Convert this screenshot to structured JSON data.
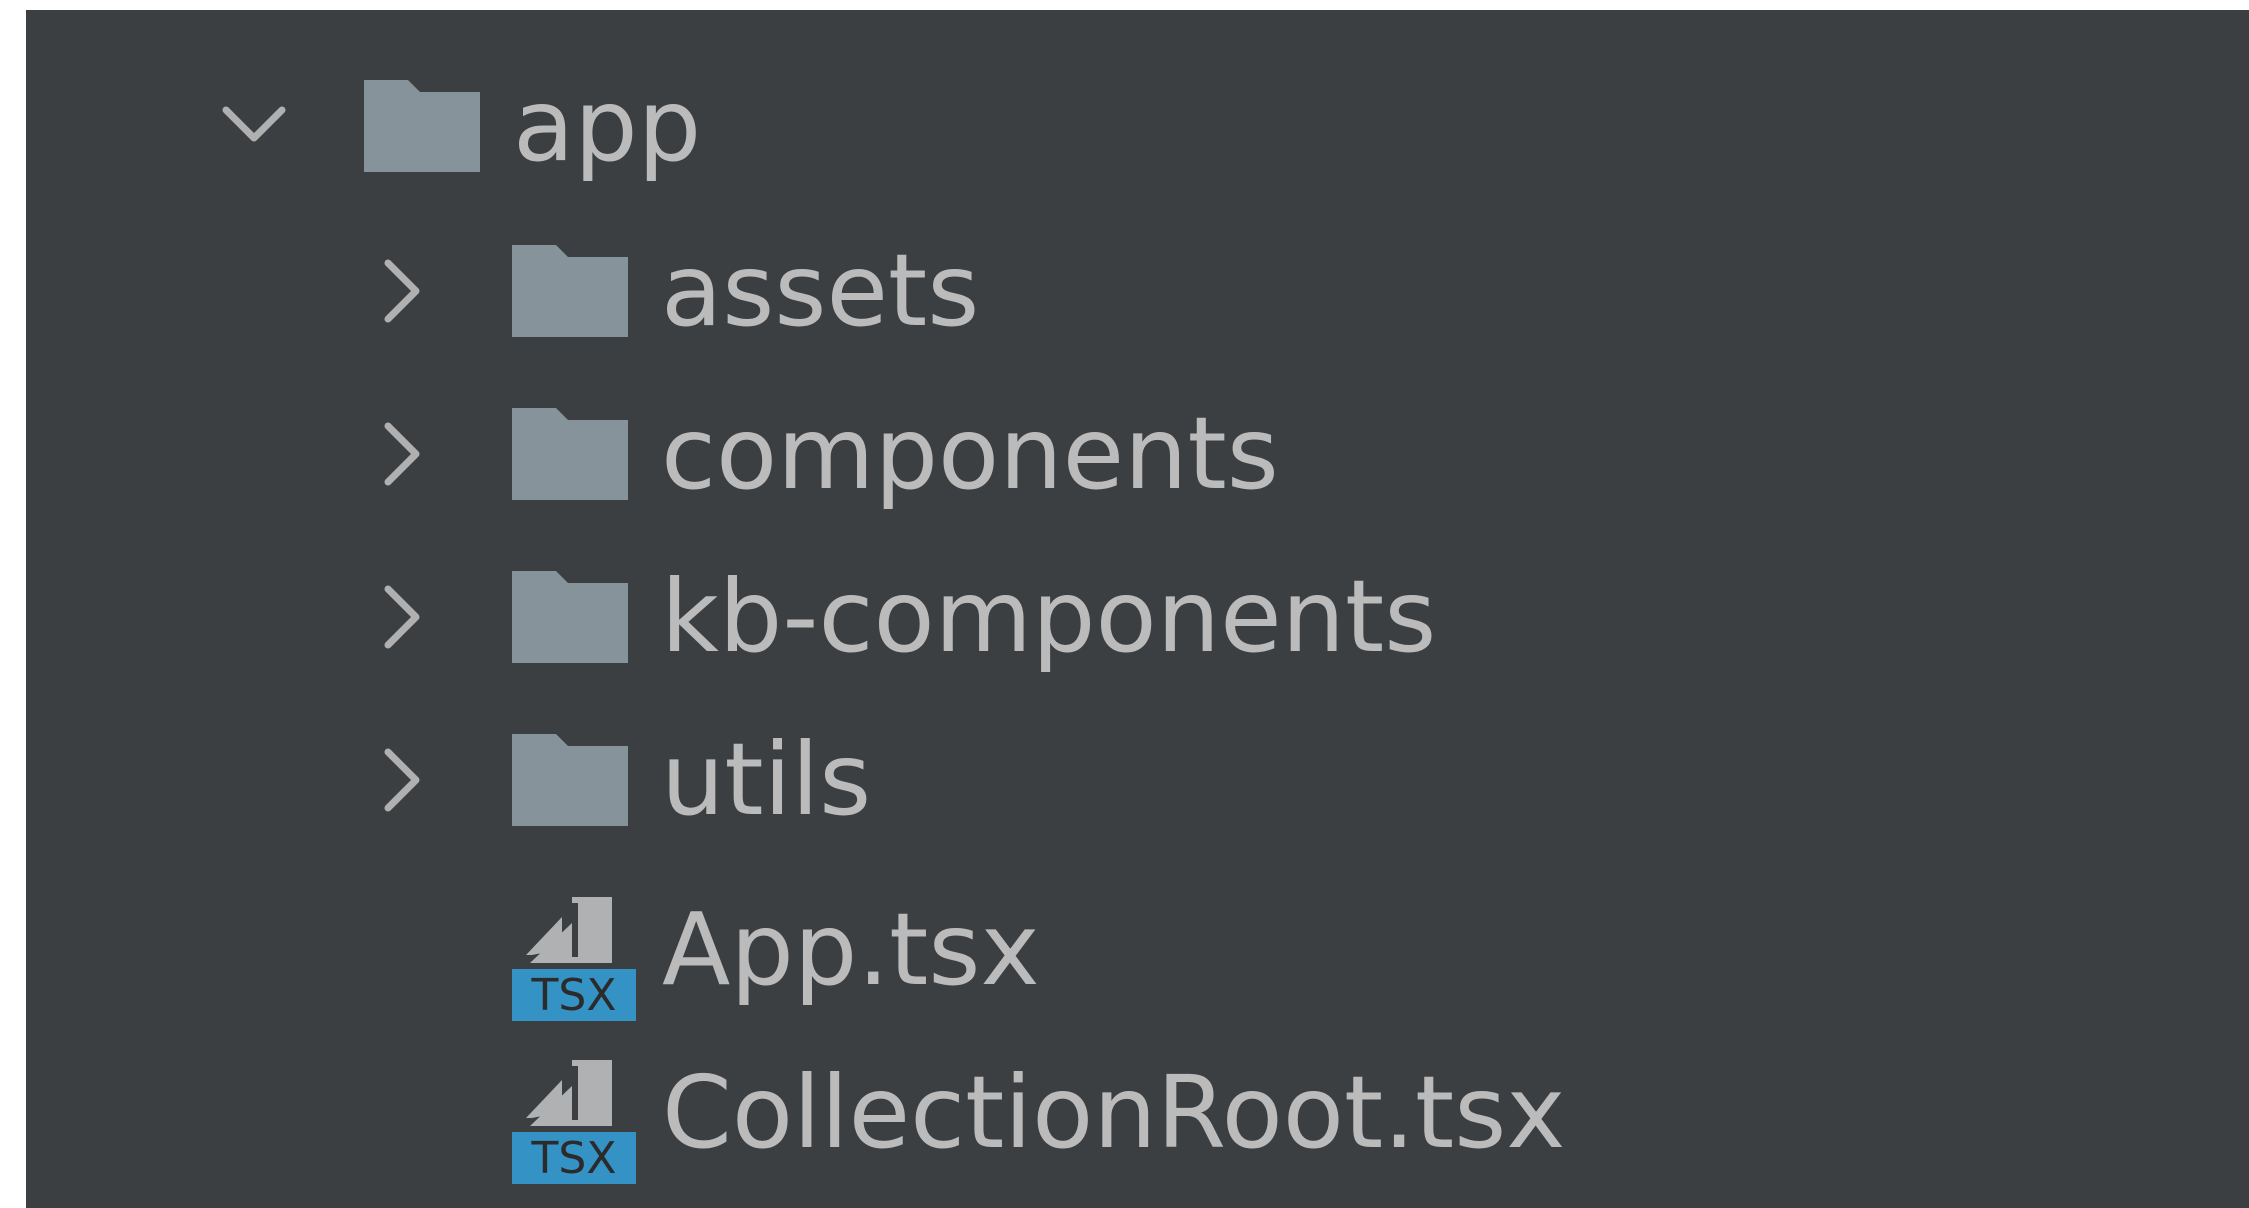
{
  "colors": {
    "background": "#3c3f41",
    "text": "#bbbbbb",
    "folder": "#87939a",
    "chevron": "#b0b0b0",
    "tsx_badge": "#3592c4",
    "tsx_doc": "#afb1b3"
  },
  "tree": {
    "root": {
      "label": "app",
      "expanded": true,
      "icon": "folder-icon",
      "toggle_icon": "chevron-down-icon"
    },
    "folders": [
      {
        "label": "assets",
        "expanded": false,
        "icon": "folder-icon",
        "toggle_icon": "chevron-right-icon"
      },
      {
        "label": "components",
        "expanded": false,
        "icon": "folder-icon",
        "toggle_icon": "chevron-right-icon"
      },
      {
        "label": "kb-components",
        "expanded": false,
        "icon": "folder-icon",
        "toggle_icon": "chevron-right-icon"
      },
      {
        "label": "utils",
        "expanded": false,
        "icon": "folder-icon",
        "toggle_icon": "chevron-right-icon"
      }
    ],
    "files": [
      {
        "label": "App.tsx",
        "icon": "tsx-file-icon",
        "badge": "TSX"
      },
      {
        "label": "CollectionRoot.tsx",
        "icon": "tsx-file-icon",
        "badge": "TSX"
      }
    ]
  }
}
